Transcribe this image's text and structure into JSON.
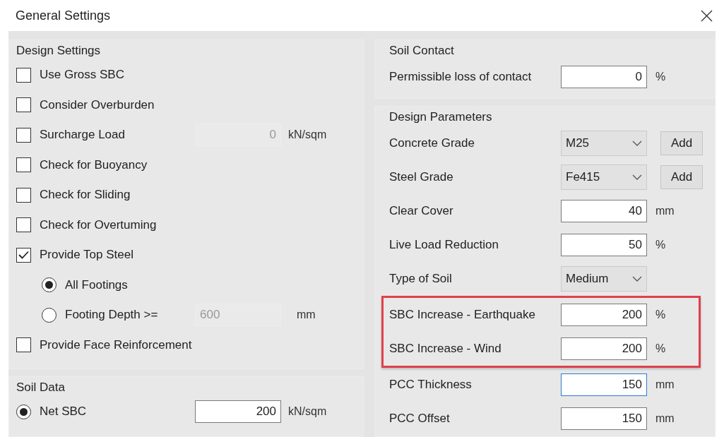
{
  "window": {
    "title": "General Settings"
  },
  "design_settings": {
    "title": "Design Settings",
    "items": [
      {
        "kind": "checkbox",
        "label": "Use Gross SBC",
        "checked": false
      },
      {
        "kind": "checkbox",
        "label": "Consider Overburden",
        "checked": false
      },
      {
        "kind": "checkbox",
        "label": "Surcharge Load",
        "checked": false,
        "field": {
          "value": "0",
          "disabled": true
        },
        "unit": "kN/sqm"
      },
      {
        "kind": "checkbox",
        "label": "Check for Buoyancy",
        "checked": false
      },
      {
        "kind": "checkbox",
        "label": "Check for Sliding",
        "checked": false
      },
      {
        "kind": "checkbox",
        "label": "Check for Overtuming",
        "checked": false
      },
      {
        "kind": "checkbox",
        "label": "Provide Top Steel",
        "checked": true,
        "children": [
          {
            "kind": "radio",
            "label": "All Footings",
            "selected": true
          },
          {
            "kind": "radio",
            "label": "Footing Depth >=",
            "selected": false,
            "field": {
              "value": "600",
              "disabled": true
            },
            "unit": "mm"
          }
        ]
      },
      {
        "kind": "checkbox",
        "label": "Provide Face Reinforcement",
        "checked": false
      }
    ]
  },
  "soil_data": {
    "title": "Soil Data",
    "items": [
      {
        "kind": "radio",
        "label": "Net SBC",
        "selected": true,
        "field": {
          "value": "200",
          "disabled": false
        },
        "unit": "kN/sqm"
      }
    ]
  },
  "soil_contact": {
    "title": "Soil Contact",
    "rows": [
      {
        "kind": "field",
        "label": "Permissible loss of contact",
        "value": "0",
        "unit": "%"
      }
    ]
  },
  "design_parameters": {
    "title": "Design Parameters",
    "rows": [
      {
        "kind": "select",
        "label": "Concrete Grade",
        "value": "M25",
        "button": "Add"
      },
      {
        "kind": "select",
        "label": "Steel Grade",
        "value": "Fe415",
        "button": "Add"
      },
      {
        "kind": "field",
        "label": "Clear Cover",
        "value": "40",
        "unit": "mm"
      },
      {
        "kind": "field",
        "label": "Live Load Reduction",
        "value": "50",
        "unit": "%"
      },
      {
        "kind": "select",
        "label": "Type of Soil",
        "value": "Medium"
      },
      {
        "kind": "field",
        "label": "SBC Increase - Earthquake",
        "value": "200",
        "unit": "%",
        "highlighted": true
      },
      {
        "kind": "field",
        "label": "SBC Increase - Wind",
        "value": "200",
        "unit": "%",
        "highlighted": true
      },
      {
        "kind": "field",
        "label": "PCC Thickness",
        "value": "150",
        "unit": "mm",
        "focused": true
      },
      {
        "kind": "field",
        "label": "PCC Offset",
        "value": "150",
        "unit": "mm"
      }
    ]
  }
}
